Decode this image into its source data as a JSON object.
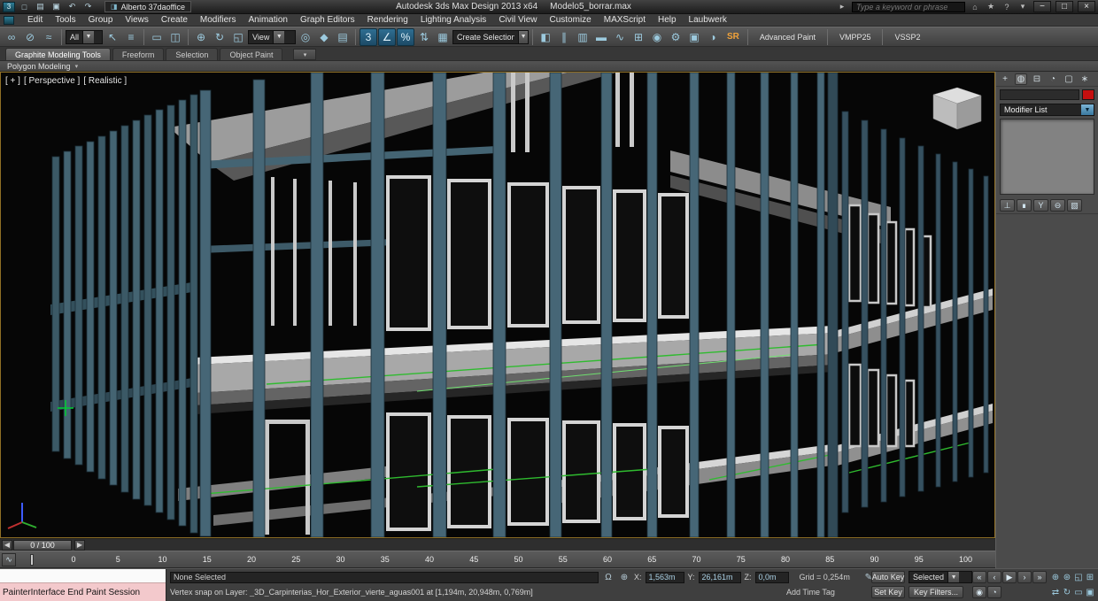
{
  "titlebar": {
    "quick_access": {
      "new_glyph": "□",
      "open_glyph": "▤",
      "save_glyph": "▣",
      "undo_glyph": "↶",
      "redo_glyph": "↷"
    },
    "workspace_value": "Alberto 37daoffice",
    "app_title": "Autodesk 3ds Max Design 2013 x64",
    "doc_title": "Modelo5_borrar.max",
    "search_placeholder": "Type a keyword or phrase",
    "window": {
      "minimize": "−",
      "maximize": "□",
      "close": "×"
    }
  },
  "menubar": {
    "items": [
      "Edit",
      "Tools",
      "Group",
      "Views",
      "Create",
      "Modifiers",
      "Animation",
      "Graph Editors",
      "Rendering",
      "Lighting Analysis",
      "Civil View",
      "Customize",
      "MAXScript",
      "Help",
      "Laubwerk"
    ]
  },
  "toolbar": {
    "filter_value": "All",
    "coord_value": "View",
    "selection_set_value": "Create Selection Se",
    "sr_label": "SR",
    "groups": {
      "link": [
        {
          "name": "select-and-link-icon",
          "glyph": "∞"
        },
        {
          "name": "unlink-selection-icon",
          "glyph": "⊘"
        },
        {
          "name": "bind-to-space-warp-icon",
          "glyph": "≈"
        }
      ],
      "select": [
        {
          "name": "select-object-icon",
          "glyph": "↖"
        },
        {
          "name": "select-by-name-icon",
          "glyph": "≡"
        }
      ],
      "region": [
        {
          "name": "rectangular-selection-region-icon",
          "glyph": "▭"
        },
        {
          "name": "window-crossing-icon",
          "glyph": "◫"
        }
      ],
      "transform": [
        {
          "name": "select-and-move-icon",
          "glyph": "⊕"
        },
        {
          "name": "select-and-rotate-icon",
          "glyph": "↻"
        },
        {
          "name": "select-and-scale-icon",
          "glyph": "◱"
        }
      ],
      "pivot": [
        {
          "name": "use-pivot-center-icon",
          "glyph": "◎"
        },
        {
          "name": "select-and-manipulate-icon",
          "glyph": "◆"
        },
        {
          "name": "keyboard-shortcut-override-icon",
          "glyph": "▤"
        }
      ],
      "snaps": [
        {
          "name": "snaps-toggle-3d-icon",
          "glyph": "3",
          "cls": "tbtn active"
        },
        {
          "name": "angle-snap-toggle-icon",
          "glyph": "∠",
          "cls": "tbtn active"
        },
        {
          "name": "percent-snap-toggle-icon",
          "glyph": "%",
          "cls": "tbtn active"
        },
        {
          "name": "spinner-snap-toggle-icon",
          "glyph": "⇅"
        }
      ],
      "sets": [
        {
          "name": "edit-named-selection-sets-icon",
          "glyph": "▦"
        }
      ],
      "tools": [
        {
          "name": "mirror-icon",
          "glyph": "◧"
        },
        {
          "name": "align-icon",
          "glyph": "∥"
        },
        {
          "name": "layer-manager-icon",
          "glyph": "▥"
        },
        {
          "name": "ribbon-toggle-icon",
          "glyph": "▬"
        },
        {
          "name": "curve-editor-icon",
          "glyph": "∿"
        },
        {
          "name": "schematic-view-icon",
          "glyph": "⊞"
        },
        {
          "name": "material-editor-icon",
          "glyph": "◉"
        },
        {
          "name": "render-setup-icon",
          "glyph": "⚙"
        },
        {
          "name": "rendered-frame-window-icon",
          "glyph": "▣"
        },
        {
          "name": "render-production-icon",
          "glyph": "◑"
        }
      ]
    },
    "buttons": [
      {
        "label": "Advanced Paint"
      },
      {
        "label": "VMPP25"
      },
      {
        "label": "VSSP2"
      }
    ]
  },
  "ribbon": {
    "tabs": [
      {
        "label": "Graphite Modeling Tools",
        "cls": "rtab active"
      },
      {
        "label": "Freeform"
      },
      {
        "label": "Selection"
      },
      {
        "label": "Object Paint"
      }
    ],
    "overflow_glyph": "▾",
    "subtab_label": "Polygon Modeling",
    "subtab_caret": "▾"
  },
  "viewport": {
    "menu_general": "[ + ]",
    "menu_pov": "[ Perspective ]",
    "menu_shading": "[ Realistic ]"
  },
  "command_panel": {
    "tabs": [
      {
        "name": "create-tab-icon",
        "glyph": "+"
      },
      {
        "name": "modify-tab-icon",
        "glyph": "◍",
        "cls": "cptab active"
      },
      {
        "name": "hierarchy-tab-icon",
        "glyph": "⊟"
      },
      {
        "name": "motion-tab-icon",
        "glyph": "◔"
      },
      {
        "name": "display-tab-icon",
        "glyph": "▢"
      },
      {
        "name": "utilities-tab-icon",
        "glyph": "∗"
      }
    ],
    "modifier_list_label": "Modifier List",
    "dropdown_arrow": "▼",
    "stack_buttons": [
      {
        "name": "pin-stack-icon",
        "glyph": "⊥"
      },
      {
        "name": "show-end-result-icon",
        "glyph": "∎"
      },
      {
        "name": "make-unique-icon",
        "glyph": "Y"
      },
      {
        "name": "remove-modifier-icon",
        "glyph": "⊖"
      },
      {
        "name": "configure-modifier-sets-icon",
        "glyph": "▧"
      }
    ]
  },
  "timeline": {
    "slider_value": "0 / 100",
    "left_arrow": "◀",
    "right_arrow": "▶",
    "mini_curve_glyph": "∿",
    "ticks": [
      "0",
      "5",
      "10",
      "15",
      "20",
      "25",
      "30",
      "35",
      "40",
      "45",
      "50",
      "55",
      "60",
      "65",
      "70",
      "75",
      "80",
      "85",
      "90",
      "95",
      "100"
    ]
  },
  "statusbar": {
    "listener_text": "PainterInterface End Paint Session",
    "selection_status": "None Selected",
    "lock_glyph": "Ω",
    "offset_glyph": "⊕",
    "x_label": "X:",
    "x_value": "1,563m",
    "y_label": "Y:",
    "y_value": "26,161m",
    "z_label": "Z:",
    "z_value": "0,0m",
    "grid_value": "Grid = 0,254m",
    "pen_glyph": "✎",
    "prompt": "Vertex snap on Layer: _3D_Carpinterias_Hor_Exterior_vierte_aguas001 at [1,194m, 20,948m, 0,769m]",
    "add_time_tag": "Add Time Tag",
    "auto_key": "Auto Key",
    "set_key": "Set Key",
    "selected_value": "Selected",
    "key_filters": "Key Filters...",
    "playback": [
      {
        "name": "go-to-start-icon",
        "glyph": "«"
      },
      {
        "name": "previous-frame-icon",
        "glyph": "‹"
      },
      {
        "name": "play-animation-icon",
        "glyph": "▶"
      },
      {
        "name": "next-frame-icon",
        "glyph": "›"
      },
      {
        "name": "go-to-end-icon",
        "glyph": "»"
      }
    ],
    "anim_extra": [
      {
        "name": "key-mode-toggle-icon",
        "glyph": "◉"
      },
      {
        "name": "time-configuration-icon",
        "glyph": "◔"
      }
    ],
    "nav_row1": [
      {
        "name": "zoom-icon",
        "glyph": "⊕"
      },
      {
        "name": "zoom-all-icon",
        "glyph": "⊛"
      },
      {
        "name": "zoom-extents-icon",
        "glyph": "◱"
      },
      {
        "name": "zoom-extents-all-icon",
        "glyph": "⊞"
      }
    ],
    "nav_row2": [
      {
        "name": "pan-view-icon",
        "glyph": "⇄"
      },
      {
        "name": "orbit-icon",
        "glyph": "↻"
      },
      {
        "name": "field-of-view-icon",
        "glyph": "▭"
      },
      {
        "name": "maximize-viewport-icon",
        "glyph": "▣"
      }
    ]
  },
  "colors": {
    "accent_blue": "#2f6e92",
    "viewport_border": "#8f6f25",
    "object_color": "#c50f0f",
    "snap_green": "#2fbb2f",
    "column_teal": "#466676"
  }
}
